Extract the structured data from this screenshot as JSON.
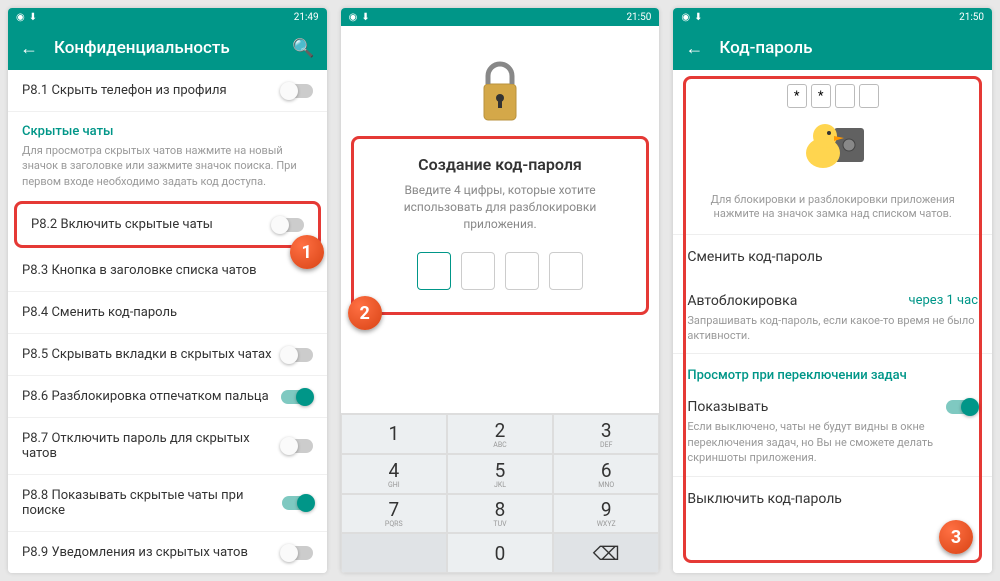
{
  "status": {
    "time": "21:49",
    "time2": "21:50",
    "time3": "21:50"
  },
  "phone1": {
    "title": "Конфиденциальность",
    "row_p81": "P8.1 Скрыть телефон из профиля",
    "section_hidden": "Скрытые чаты",
    "section_hidden_desc": "Для просмотра скрытых чатов нажмите на новый значок в заголовке или зажмите значок поиска. При первом входе необходимо задать код доступа.",
    "row_p82": "P8.2 Включить скрытые чаты",
    "row_p83": "P8.3 Кнопка в заголовке списка чатов",
    "row_p84": "P8.4 Сменить код-пароль",
    "row_p85": "P8.5 Скрывать вкладки в скрытых чатах",
    "row_p86": "P8.6 Разблокировка отпечатком пальца",
    "row_p87": "P8.7 Отключить пароль для скрытых чатов",
    "row_p88": "P8.8 Показывать скрытые чаты при поиске",
    "row_p89": "P8.9 Уведомления из скрытых чатов"
  },
  "phone2": {
    "title": "Создание код-пароля",
    "desc": "Введите 4 цифры, которые хотите использовать для разблокировки приложения.",
    "keys": {
      "1": "1",
      "2": "2",
      "3": "3",
      "4": "4",
      "5": "5",
      "6": "6",
      "7": "7",
      "8": "8",
      "9": "9",
      "0": "0",
      "abc": "ABC",
      "def": "DEF",
      "ghi": "GHI",
      "jkl": "JKL",
      "mno": "MNO",
      "pqrs": "PQRS",
      "tuv": "TUV",
      "wxyz": "WXYZ"
    }
  },
  "phone3": {
    "title": "Код-пароль",
    "dot": "*",
    "desc": "Для блокировки и разблокировки приложения нажмите на значок замка над списком чатов.",
    "row_change": "Сменить код-пароль",
    "row_autolock": "Автоблокировка",
    "autolock_value": "через 1 час",
    "autolock_sub": "Запрашивать код-пароль, если какое-то время не было активности.",
    "section_preview": "Просмотр при переключении задач",
    "row_show": "Показывать",
    "show_sub": "Если выключено, чаты не будут видны в окне переключения задач, но Вы не сможете делать скриншоты приложения.",
    "row_disable": "Выключить код-пароль"
  },
  "badges": {
    "b1": "1",
    "b2": "2",
    "b3": "3"
  }
}
